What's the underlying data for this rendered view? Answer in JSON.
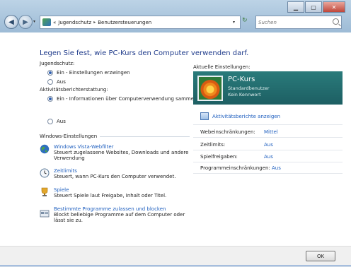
{
  "window": {
    "minimize_glyph": "▁",
    "maximize_glyph": "▢",
    "close_glyph": "✕"
  },
  "nav": {
    "back_glyph": "◀",
    "forward_glyph": "▶",
    "dropdown_glyph": "▾",
    "refresh_glyph": "↻"
  },
  "address": {
    "breadcrumb": [
      "Jugendschutz",
      "Benutzersteuerungen"
    ],
    "overflow": "«",
    "separator": "▸",
    "dropdown_glyph": "▾"
  },
  "search": {
    "placeholder": "Suchen"
  },
  "main": {
    "heading": "Legen Sie fest, wie PC-Kurs den Computer verwenden darf.",
    "parental_control": {
      "label": "Jugendschutz:",
      "options": [
        "Ein - Einstellungen erzwingen",
        "Aus"
      ],
      "selected": 0
    },
    "activity_reporting": {
      "label": "Aktivitätsberichterstattung:",
      "options": [
        "Ein - Informationen über Computerverwendung sammeln",
        "Aus"
      ],
      "selected": 0
    },
    "windows_settings_label": "Windows-Einstellungen",
    "tasks": [
      {
        "link": "Windows Vista-Webfilter",
        "desc": "Steuert zugelassene Websites, Downloads und andere Verwendung",
        "icon": "globe-icon"
      },
      {
        "link": "Zeitlimits",
        "desc": "Steuert, wann PC-Kurs den Computer verwendet.",
        "icon": "clock-icon"
      },
      {
        "link": "Spiele",
        "desc": "Steuert Spiele laut Freigabe, Inhalt oder Titel.",
        "icon": "games-trophy-icon"
      },
      {
        "link": "Bestimmte Programme zulassen und blocken",
        "desc": "Blockt beliebige Programme auf dem Computer oder lässt sie zu.",
        "icon": "programs-icon"
      }
    ]
  },
  "current": {
    "title": "Aktuelle Einstellungen:",
    "user": {
      "name": "PC-Kurs",
      "type": "Standardbenutzer",
      "password": "Kein Kennwort"
    },
    "reports_link": "Aktivitätsberichte anzeigen",
    "settings": [
      {
        "label": "Webeinschränkungen:",
        "value": "Mittel"
      },
      {
        "label": "Zeitlimits:",
        "value": "Aus"
      },
      {
        "label": "Spielfreigaben:",
        "value": "Aus"
      },
      {
        "label": "Programmeinschränkungen:",
        "value": "Aus"
      }
    ]
  },
  "footer": {
    "ok_label": "OK"
  },
  "colors": {
    "link": "#1f5fbf",
    "heading": "#1e3a8a",
    "user_panel": "#2a7b7b"
  }
}
